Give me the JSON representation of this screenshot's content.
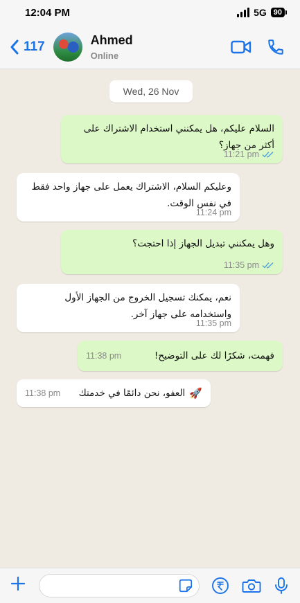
{
  "status_bar": {
    "time": "12:04 PM",
    "network": "5G",
    "battery": "90"
  },
  "header": {
    "back_count": "117",
    "contact_name": "Ahmed",
    "contact_status": "Online",
    "icons": [
      "back-chevron-icon",
      "video-call-icon",
      "phone-icon"
    ],
    "accent_color": "#1a73e8"
  },
  "chat": {
    "date": "Wed, 26 Nov",
    "messages": [
      {
        "direction": "out",
        "text": "السلام عليكم، هل يمكنني استخدام الاشتراك على أكثر من جهاز؟",
        "time": "11:21 pm",
        "read": true
      },
      {
        "direction": "in",
        "text": "وعليكم السلام، الاشتراك يعمل على جهاز واحد فقط في نفس الوقت.",
        "time": "11:24 pm"
      },
      {
        "direction": "out",
        "text": "وهل يمكنني تبديل الجهاز إذا احتجت؟",
        "time": "11:35 pm",
        "read": true
      },
      {
        "direction": "in",
        "text": "نعم، يمكنك تسجيل الخروج من الجهاز الأول واستخدامه على جهاز آخر.",
        "time": "11:35 pm"
      },
      {
        "direction": "out",
        "text": "فهمت، شكرًا لك على التوضيح!",
        "time": "11:38 pm"
      },
      {
        "direction": "in",
        "text": "العفو، نحن دائمًا في خدمتك",
        "emoji": "🚀",
        "time": "11:38 pm"
      }
    ],
    "outgoing_color": "#dcf8c6",
    "incoming_color": "#ffffff",
    "read_tick_color": "#4fa3e0"
  },
  "composer": {
    "placeholder": "",
    "icons": [
      "plus-icon",
      "sticker-icon",
      "rupee-icon",
      "camera-icon",
      "microphone-icon"
    ]
  }
}
